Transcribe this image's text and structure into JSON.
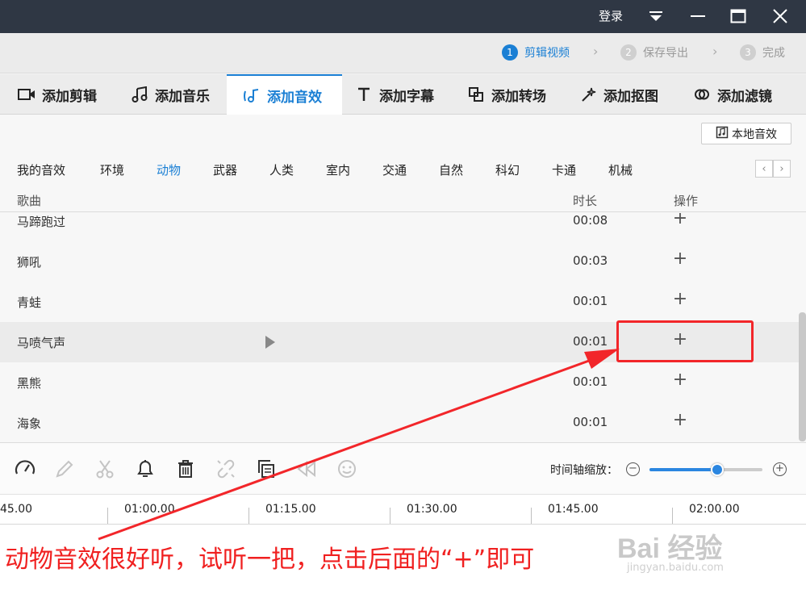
{
  "titlebar": {
    "login": "登录"
  },
  "steps": [
    {
      "num": "1",
      "label": "剪辑视频"
    },
    {
      "num": "2",
      "label": "保存导出"
    },
    {
      "num": "3",
      "label": "完成"
    }
  ],
  "tabs": [
    {
      "label": "添加剪辑",
      "icon": "video-camera-icon"
    },
    {
      "label": "添加音乐",
      "icon": "music-note-icon"
    },
    {
      "label": "添加音效",
      "icon": "sound-effect-icon"
    },
    {
      "label": "添加字幕",
      "icon": "text-t-icon"
    },
    {
      "label": "添加转场",
      "icon": "transition-icon"
    },
    {
      "label": "添加抠图",
      "icon": "magic-wand-icon"
    },
    {
      "label": "添加滤镜",
      "icon": "filter-icon"
    }
  ],
  "local_button": "本地音效",
  "categories": [
    "我的音效",
    "环境",
    "动物",
    "武器",
    "人类",
    "室内",
    "交通",
    "自然",
    "科幻",
    "卡通",
    "机械"
  ],
  "active_category": "动物",
  "table": {
    "col_song": "歌曲",
    "col_duration": "时长",
    "col_action": "操作",
    "rows": [
      {
        "name": "马蹄跑过",
        "duration": "00:08"
      },
      {
        "name": "狮吼",
        "duration": "00:03"
      },
      {
        "name": "青蛙",
        "duration": "00:01"
      },
      {
        "name": "马喷气声",
        "duration": "00:01"
      },
      {
        "name": "黑熊",
        "duration": "00:01"
      },
      {
        "name": "海象",
        "duration": "00:01"
      }
    ]
  },
  "zoom": {
    "label": "时间轴缩放：",
    "value": 0.6
  },
  "timeline_labels": [
    "45.00",
    "01:00.00",
    "01:15.00",
    "01:30.00",
    "01:45.00",
    "02:00.00"
  ],
  "annotation": "动物音效很好听，试听一把，点击后面的“+”即可",
  "watermark": {
    "main": "Bai 经验",
    "sub": "jingyan.baidu.com"
  },
  "colors": {
    "accent": "#1a7fd4",
    "annotation": "#f2262a",
    "titlebar": "#2f3744"
  }
}
